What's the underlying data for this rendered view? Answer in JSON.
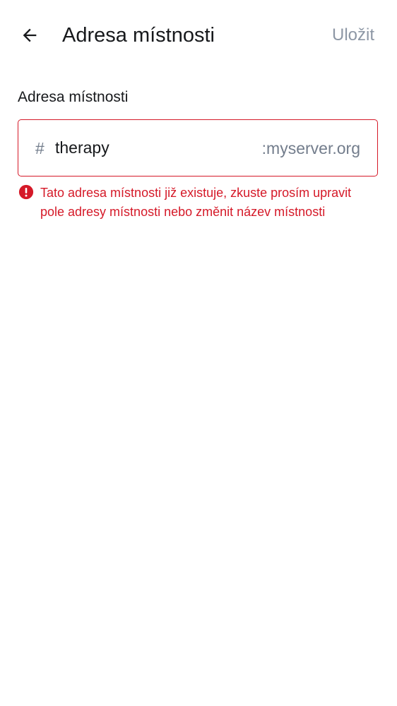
{
  "header": {
    "back_icon": "arrow-left-icon",
    "title": "Adresa místnosti",
    "save_label": "Uložit"
  },
  "address_field": {
    "label": "Adresa místnosti",
    "prefix": "#",
    "value": "therapy",
    "suffix": ":myserver.org"
  },
  "error": {
    "icon": "error-icon",
    "message": "Tato adresa místnosti již existuje, zkuste prosím upravit pole adresy místnosti nebo změnit název místnosti"
  },
  "colors": {
    "error": "#d51928",
    "text_primary": "#17191c",
    "text_secondary": "#737d8c",
    "disabled": "#8d97a5"
  }
}
